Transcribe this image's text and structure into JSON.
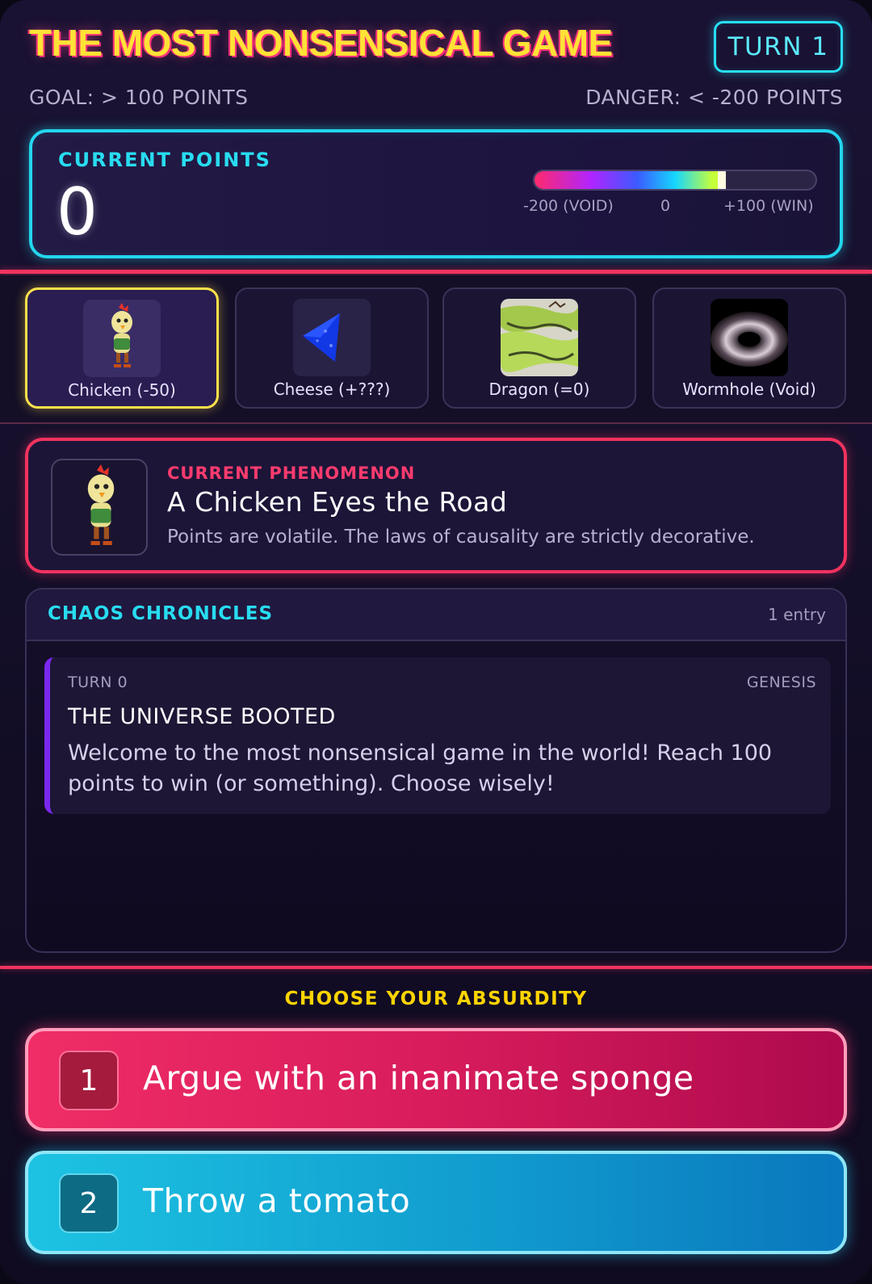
{
  "header": {
    "title": "THE MOST NONSENSICAL GAME",
    "turn_label": "TURN 1",
    "goal": "GOAL: > 100 POINTS",
    "danger": "DANGER: < -200 POINTS"
  },
  "points": {
    "label": "CURRENT POINTS",
    "value": "0",
    "meter_fraction": 0.667,
    "scale": {
      "min_label": "-200 (VOID)",
      "mid_label": "0",
      "max_label": "+100 (WIN)"
    }
  },
  "cards": [
    {
      "label": "Chicken (-50)",
      "icon": "chicken-icon",
      "selected": true
    },
    {
      "label": "Cheese (+???)",
      "icon": "cheese-icon",
      "selected": false
    },
    {
      "label": "Dragon (=0)",
      "icon": "dragon-icon",
      "selected": false
    },
    {
      "label": "Wormhole (Void)",
      "icon": "wormhole-icon",
      "selected": false
    }
  ],
  "phenomenon": {
    "tag": "CURRENT PHENOMENON",
    "title": "A Chicken Eyes the Road",
    "description": "Points are volatile. The laws of causality are strictly decorative.",
    "icon": "chicken-icon"
  },
  "chronicles": {
    "title": "CHAOS CHRONICLES",
    "count": "1 entry",
    "entries": [
      {
        "turn": "TURN 0",
        "tag": "GENESIS",
        "title": "THE UNIVERSE BOOTED",
        "text": "Welcome to the most nonsensical game in the world! Reach 100 points to win (or something). Choose wisely!"
      }
    ]
  },
  "choices": {
    "label": "CHOOSE YOUR ABSURDITY",
    "options": [
      {
        "number": "1",
        "text": "Argue with an inanimate sponge"
      },
      {
        "number": "2",
        "text": "Throw a tomato"
      }
    ]
  },
  "colors": {
    "title": "#ffe236",
    "accent_cyan": "#23d6ee",
    "accent_pink": "#f2325f",
    "highlight_yellow": "#ffe14a",
    "choice_1": "#e0215e",
    "choice_2": "#15b0da"
  }
}
